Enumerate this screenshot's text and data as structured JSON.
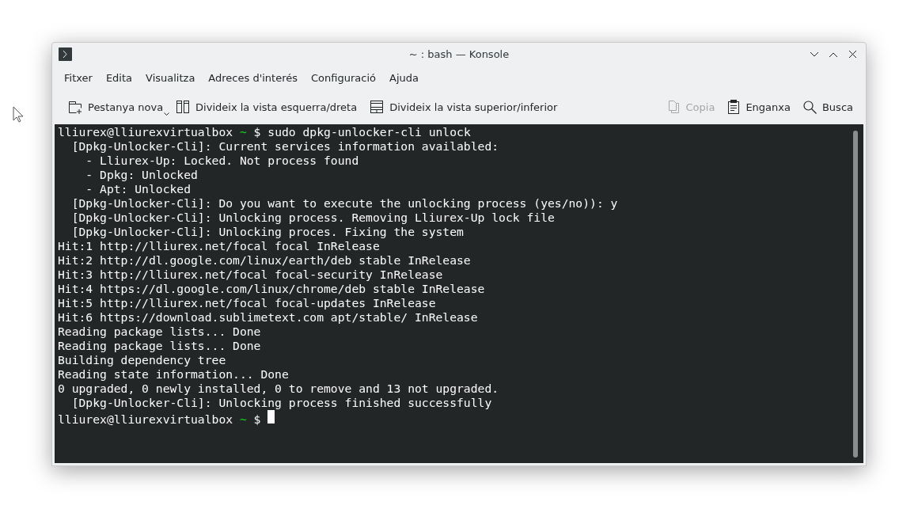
{
  "window": {
    "title": "~ : bash — Konsole"
  },
  "menu": [
    "Fitxer",
    "Edita",
    "Visualitza",
    "Adreces d'interés",
    "Configuració",
    "Ajuda"
  ],
  "toolbar": [
    {
      "kind": "new-tab",
      "label": "Pestanya nova",
      "disabled": false,
      "dropdown": true
    },
    {
      "kind": "split-lr",
      "label": "Divideix la vista esquerra/dreta",
      "disabled": false,
      "dropdown": false
    },
    {
      "kind": "split-tb",
      "label": "Divideix la vista superior/inferior",
      "disabled": false,
      "dropdown": false
    },
    {
      "kind": "spacer"
    },
    {
      "kind": "copy",
      "label": "Copia",
      "disabled": true,
      "dropdown": false
    },
    {
      "kind": "paste",
      "label": "Enganxa",
      "disabled": false,
      "dropdown": false
    },
    {
      "kind": "search",
      "label": "Busca",
      "disabled": false,
      "dropdown": false
    }
  ],
  "terminal": {
    "lines": [
      {
        "kind": "prompt",
        "user": "lliurex@lliurexvirtualbox",
        "dir": "~",
        "command": "$ sudo dpkg-unlocker-cli unlock",
        "cursor": false
      },
      {
        "kind": "output",
        "text": "  [Dpkg-Unlocker-Cli]: Current services information availabled:"
      },
      {
        "kind": "output",
        "text": "    - Lliurex-Up: Locked. Not process found"
      },
      {
        "kind": "output",
        "text": "    - Dpkg: Unlocked"
      },
      {
        "kind": "output",
        "text": "    - Apt: Unlocked"
      },
      {
        "kind": "output",
        "text": "  [Dpkg-Unlocker-Cli]: Do you want to execute the unlocking process (yes/no)): y"
      },
      {
        "kind": "output",
        "text": "  [Dpkg-Unlocker-Cli]: Unlocking process. Removing Lliurex-Up lock file"
      },
      {
        "kind": "output",
        "text": "  [Dpkg-Unlocker-Cli]: Unlocking proces. Fixing the system"
      },
      {
        "kind": "output",
        "text": "Hit:1 http://lliurex.net/focal focal InRelease"
      },
      {
        "kind": "output",
        "text": "Hit:2 http://dl.google.com/linux/earth/deb stable InRelease"
      },
      {
        "kind": "output",
        "text": "Hit:3 http://lliurex.net/focal focal-security InRelease"
      },
      {
        "kind": "output",
        "text": "Hit:4 https://dl.google.com/linux/chrome/deb stable InRelease"
      },
      {
        "kind": "output",
        "text": "Hit:5 http://lliurex.net/focal focal-updates InRelease"
      },
      {
        "kind": "output",
        "text": "Hit:6 https://download.sublimetext.com apt/stable/ InRelease"
      },
      {
        "kind": "output",
        "text": "Reading package lists... Done"
      },
      {
        "kind": "output",
        "text": "Reading package lists... Done"
      },
      {
        "kind": "output",
        "text": "Building dependency tree"
      },
      {
        "kind": "output",
        "text": "Reading state information... Done"
      },
      {
        "kind": "output",
        "text": "0 upgraded, 0 newly installed, 0 to remove and 13 not upgraded."
      },
      {
        "kind": "output",
        "text": "  [Dpkg-Unlocker-Cli]: Unlocking process finished successfully"
      },
      {
        "kind": "prompt",
        "user": "lliurex@lliurexvirtualbox",
        "dir": "~",
        "command": "$",
        "cursor": true
      }
    ]
  }
}
